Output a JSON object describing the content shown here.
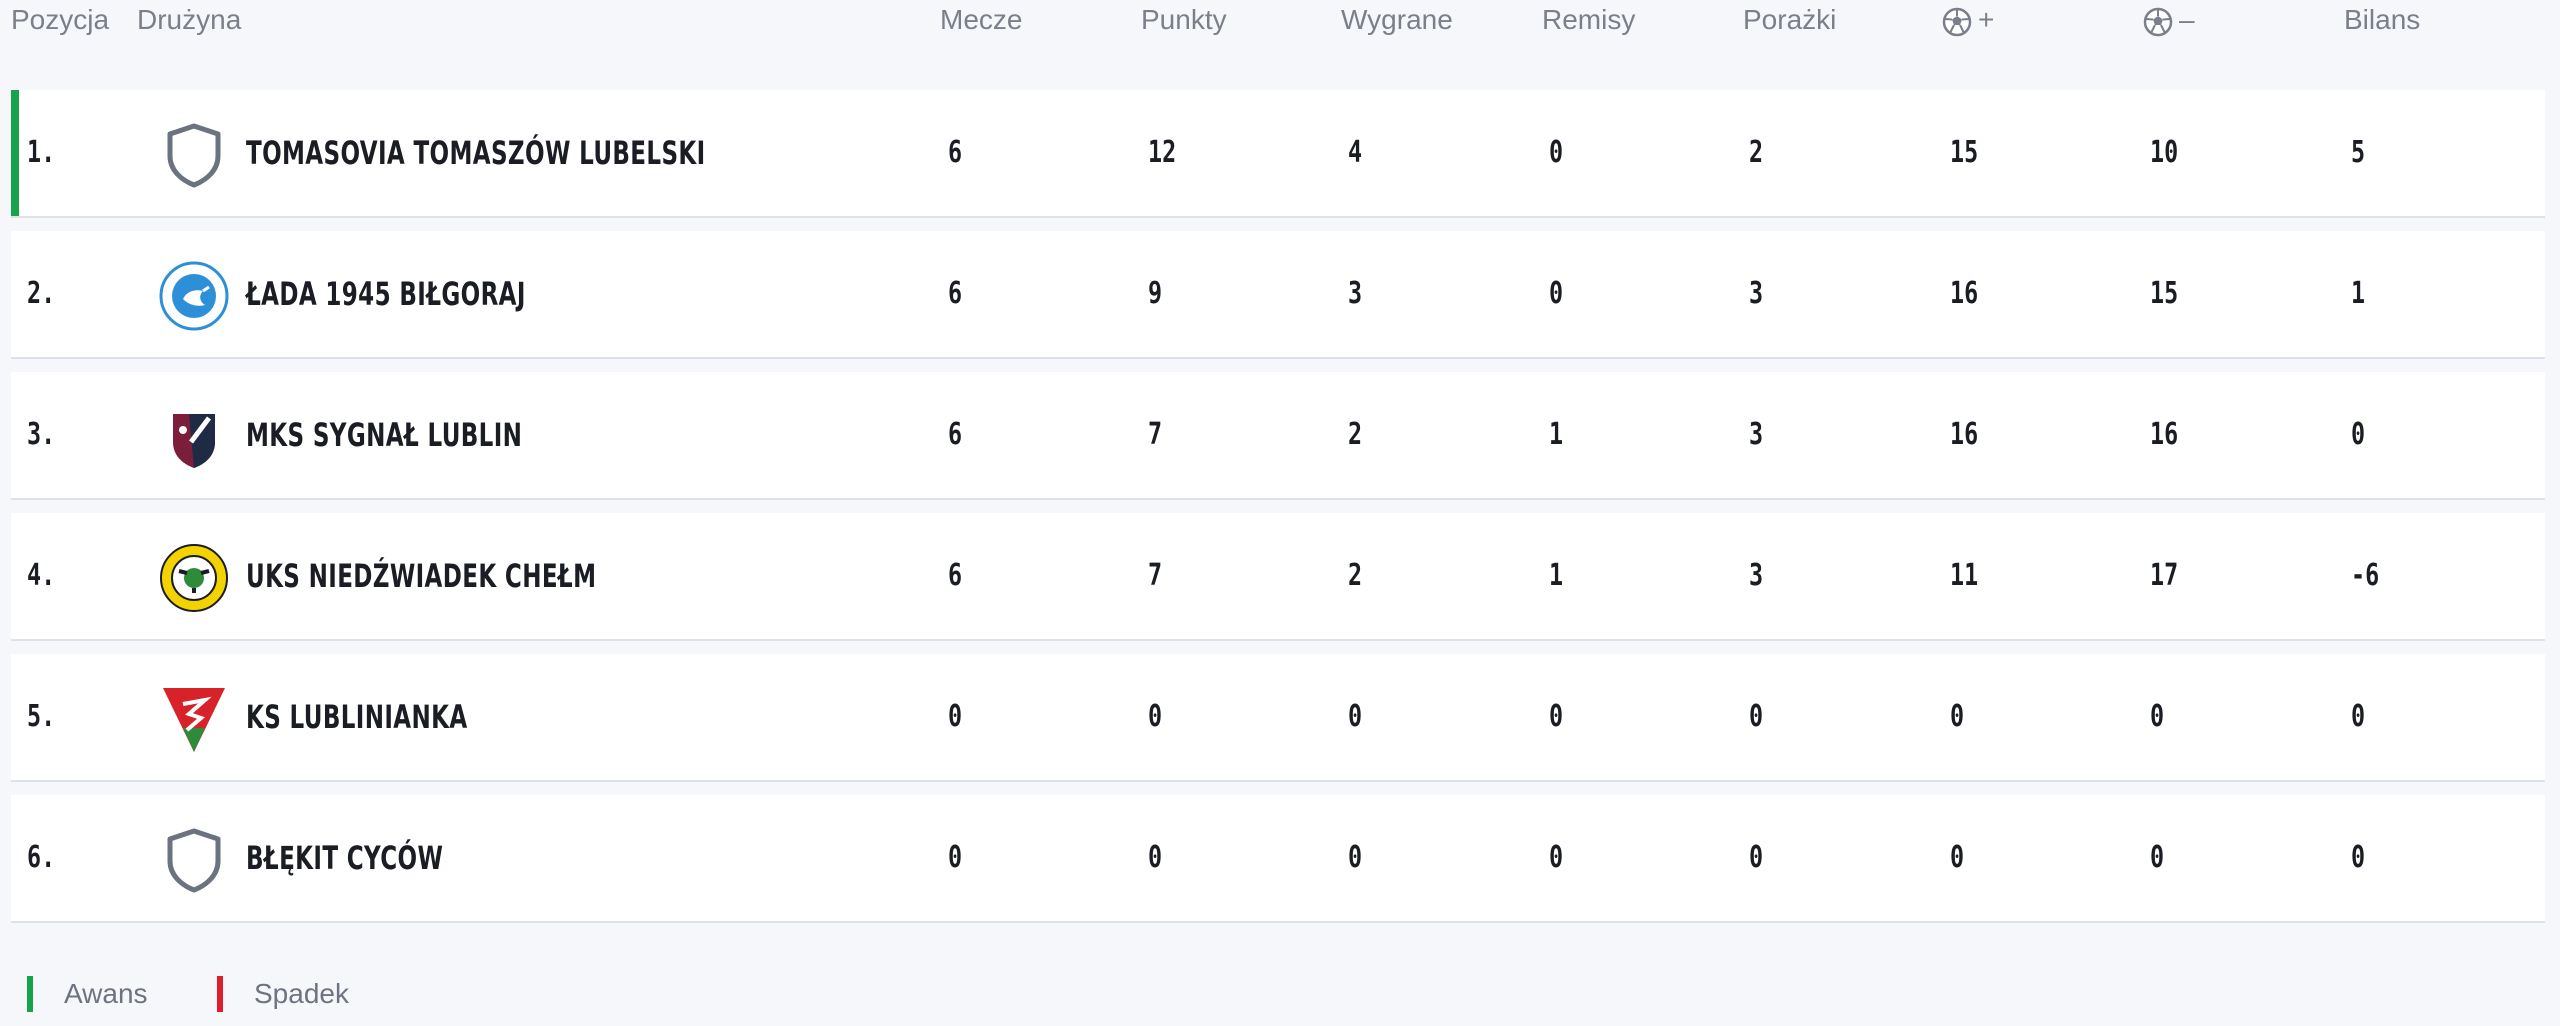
{
  "headers": {
    "position": "Pozycja",
    "team": "Drużyna",
    "played": "Mecze",
    "points": "Punkty",
    "wins": "Wygrane",
    "draws": "Remisy",
    "losses": "Porażki",
    "goals_for": "+",
    "goals_against": "–",
    "balance": "Bilans"
  },
  "rows": [
    {
      "pos": "1.",
      "team": "TOMASOVIA TOMASZÓW LUBELSKI",
      "logo": "shield-icon",
      "played": "6",
      "points": "12",
      "wins": "4",
      "draws": "0",
      "losses": "2",
      "gf": "15",
      "ga": "10",
      "bal": "5",
      "marker_color": "#16a34a"
    },
    {
      "pos": "2.",
      "team": "ŁADA 1945 BIŁGORAJ",
      "logo": "lada-crest-icon",
      "played": "6",
      "points": "9",
      "wins": "3",
      "draws": "0",
      "losses": "3",
      "gf": "16",
      "ga": "15",
      "bal": "1",
      "marker_color": ""
    },
    {
      "pos": "3.",
      "team": "MKS SYGNAŁ LUBLIN",
      "logo": "sygnal-crest-icon",
      "played": "6",
      "points": "7",
      "wins": "2",
      "draws": "1",
      "losses": "3",
      "gf": "16",
      "ga": "16",
      "bal": "0",
      "marker_color": ""
    },
    {
      "pos": "4.",
      "team": "UKS NIEDŹWIADEK CHEŁM",
      "logo": "niedzwiadek-crest-icon",
      "played": "6",
      "points": "7",
      "wins": "2",
      "draws": "1",
      "losses": "3",
      "gf": "11",
      "ga": "17",
      "bal": "-6",
      "marker_color": ""
    },
    {
      "pos": "5.",
      "team": "KS LUBLINIANKA",
      "logo": "lublinianka-crest-icon",
      "played": "0",
      "points": "0",
      "wins": "0",
      "draws": "0",
      "losses": "0",
      "gf": "0",
      "ga": "0",
      "bal": "0",
      "marker_color": ""
    },
    {
      "pos": "6.",
      "team": "BŁĘKIT CYCÓW",
      "logo": "shield-icon",
      "played": "0",
      "points": "0",
      "wins": "0",
      "draws": "0",
      "losses": "0",
      "gf": "0",
      "ga": "0",
      "bal": "0",
      "marker_color": ""
    }
  ],
  "legend": [
    {
      "label": "Awans",
      "color": "#16a34a"
    },
    {
      "label": "Spadek",
      "color": "#e11d2a"
    }
  ]
}
